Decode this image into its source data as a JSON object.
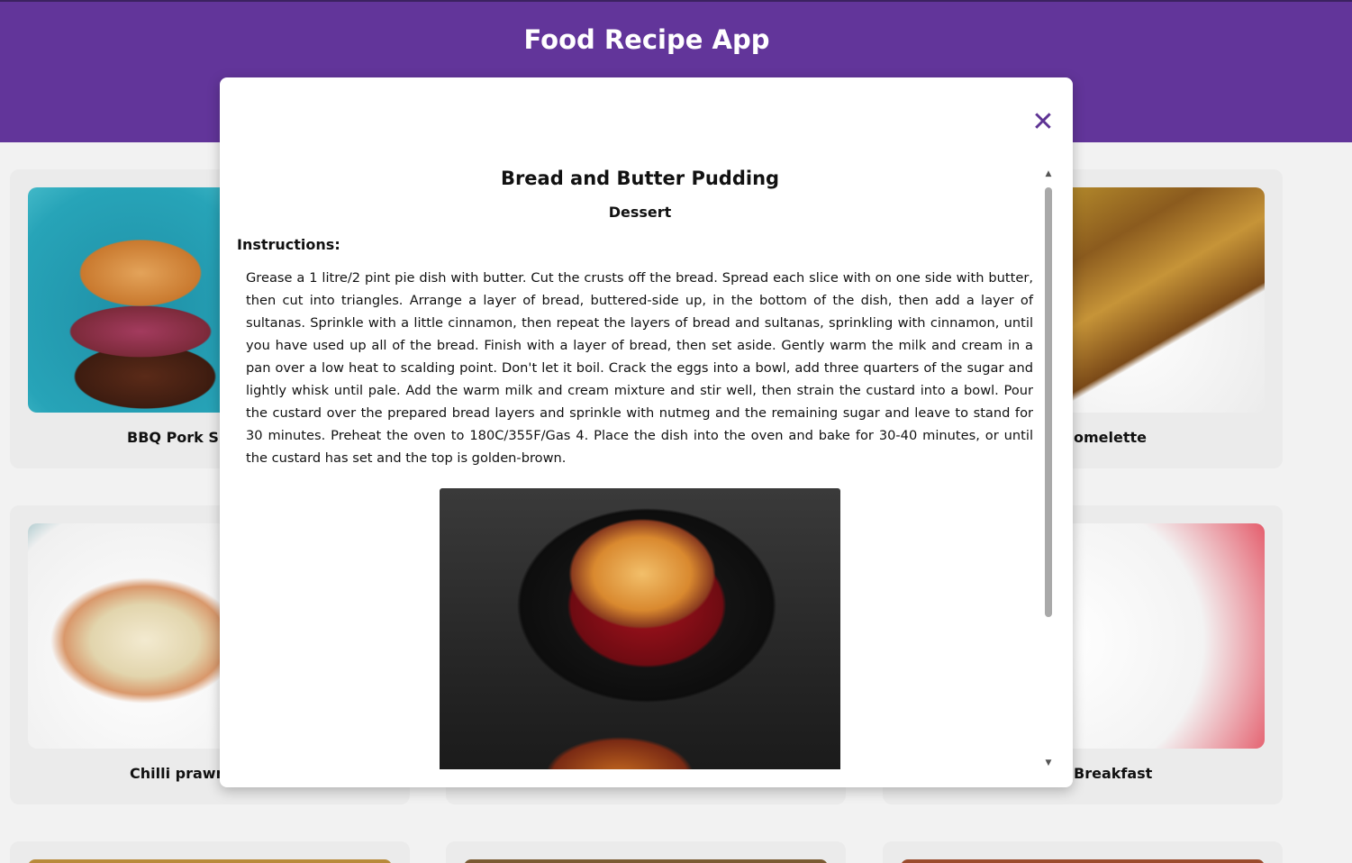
{
  "app": {
    "title": "Food Recipe App"
  },
  "cards": [
    {
      "label": "BBQ Pork Slo"
    },
    {
      "label": "omelette"
    },
    {
      "label": "Chilli prawn"
    },
    {
      "label": "Breakfast"
    }
  ],
  "modal": {
    "close_icon": "✕",
    "title": "Bread and Butter Pudding",
    "category": "Dessert",
    "instructions_heading": "Instructions:",
    "instructions": "Grease a 1 litre/2 pint pie dish with butter. Cut the crusts off the bread. Spread each slice with on one side with butter, then cut into triangles. Arrange a layer of bread, buttered-side up, in the bottom of the dish, then add a layer of sultanas. Sprinkle with a little cinnamon, then repeat the layers of bread and sultanas, sprinkling with cinnamon, until you have used up all of the bread. Finish with a layer of bread, then set aside. Gently warm the milk and cream in a pan over a low heat to scalding point. Don't let it boil. Crack the eggs into a bowl, add three quarters of the sugar and lightly whisk until pale. Add the warm milk and cream mixture and stir well, then strain the custard into a bowl. Pour the custard over the prepared bread layers and sprinkle with nutmeg and the remaining sugar and leave to stand for 30 minutes. Preheat the oven to 180C/355F/Gas 4. Place the dish into the oven and bake for 30-40 minutes, or until the custard has set and the top is golden-brown."
  },
  "colors": {
    "header": "#62359a",
    "close": "#5e3394"
  }
}
